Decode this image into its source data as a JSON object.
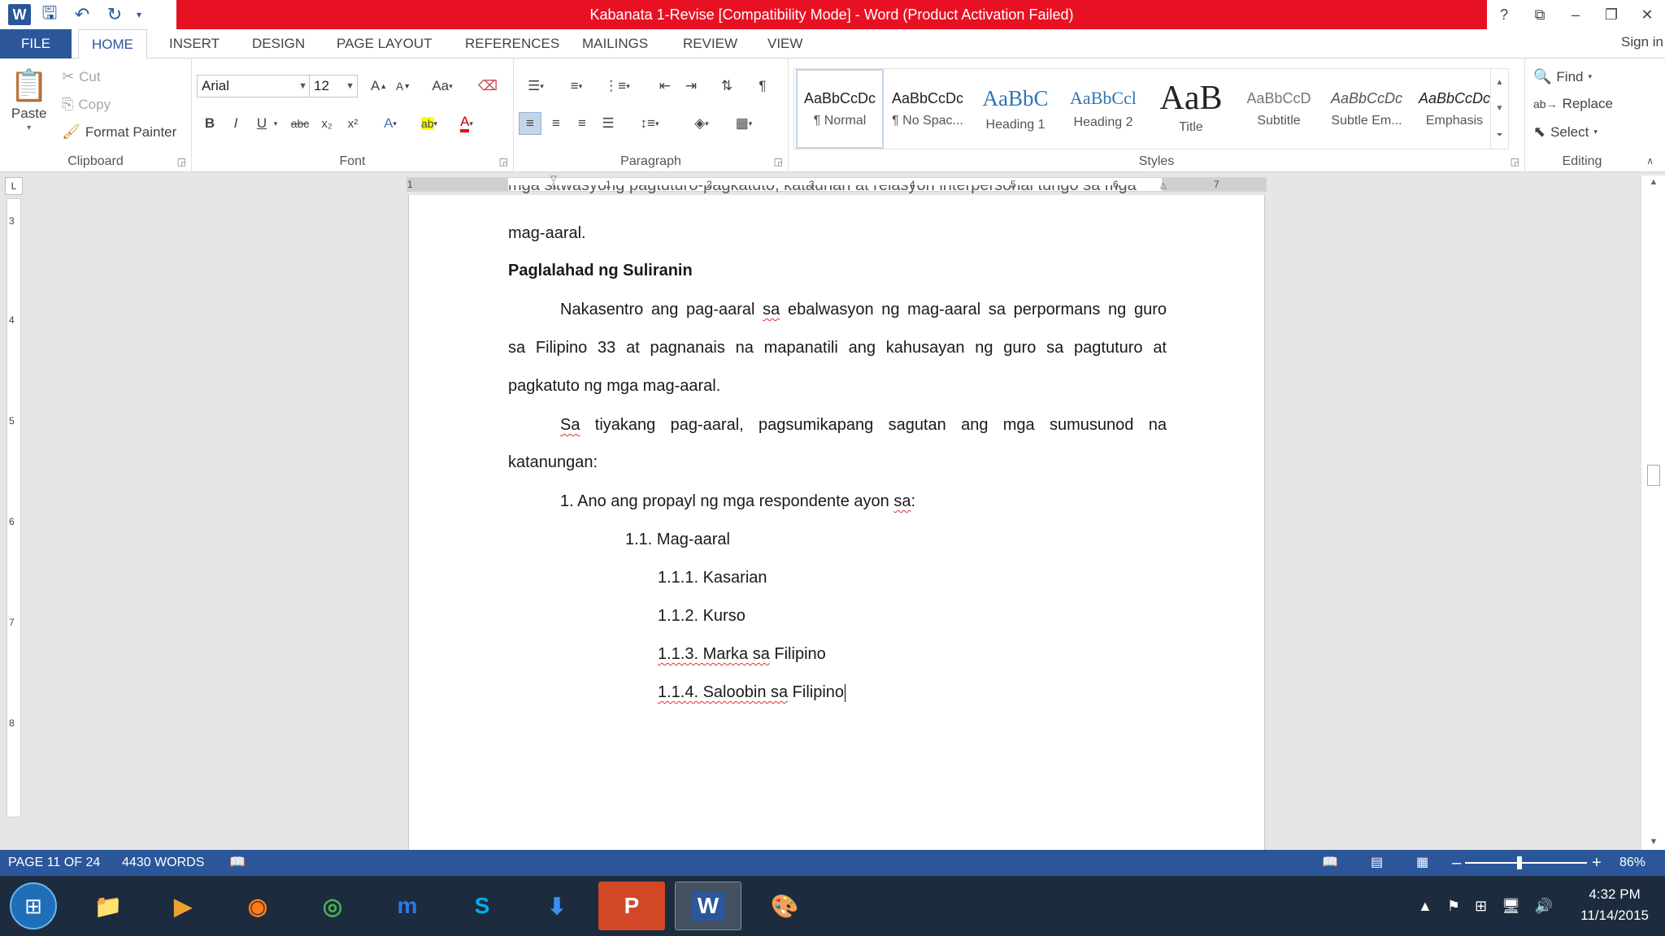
{
  "titlebar": {
    "title": "Kabanata 1-Revise [Compatibility Mode] - Word (Product Activation Failed)",
    "help": "?",
    "ribbon_display": "⧉",
    "minimize": "–",
    "restore": "❐",
    "close": "✕"
  },
  "quick_access": {
    "word_icon": "W",
    "save": "🖫",
    "undo": "↶",
    "redo": "↻",
    "customize": "▾"
  },
  "tabs": [
    "FILE",
    "HOME",
    "INSERT",
    "DESIGN",
    "PAGE LAYOUT",
    "REFERENCES",
    "MAILINGS",
    "REVIEW",
    "VIEW"
  ],
  "sign_in": "Sign in",
  "clipboard": {
    "paste": "Paste",
    "cut": "Cut",
    "copy": "Copy",
    "format_painter": "Format Painter",
    "label": "Clipboard"
  },
  "font": {
    "name": "Arial",
    "size": "12",
    "grow": "A",
    "shrink": "A",
    "change_case": "Aa",
    "bold": "B",
    "italic": "I",
    "underline": "U",
    "strike": "abc",
    "sub": "x₂",
    "sup": "x²",
    "text_effects": "A",
    "highlight": "ab",
    "font_color": "A",
    "label": "Font"
  },
  "paragraph": {
    "label": "Paragraph"
  },
  "styles": {
    "label": "Styles",
    "items": [
      {
        "preview": "AaBbCcDc",
        "name": "¶ Normal"
      },
      {
        "preview": "AaBbCcDc",
        "name": "¶ No Spac..."
      },
      {
        "preview": "AaBbC",
        "name": "Heading 1"
      },
      {
        "preview": "AaBbCcl",
        "name": "Heading 2"
      },
      {
        "preview": "AaB",
        "name": "Title"
      },
      {
        "preview": "AaBbCcD",
        "name": "Subtitle"
      },
      {
        "preview": "AaBbCcDc",
        "name": "Subtle Em..."
      },
      {
        "preview": "AaBbCcDc",
        "name": "Emphasis"
      }
    ]
  },
  "editing": {
    "find": "Find",
    "replace": "Replace",
    "select": "Select",
    "label": "Editing"
  },
  "ruler": {
    "corner": "L",
    "h_numbers": [
      "1",
      "1",
      "2",
      "3",
      "4",
      "5",
      "6",
      "7"
    ],
    "v_numbers": [
      "3",
      "4",
      "5",
      "6",
      "7",
      "8"
    ]
  },
  "document": {
    "top_cut": "mga sitwasyong pagtuturo-pagkatuto, katauhan at relasyon interpersonal tungo sa mga",
    "line1": "mag-aaral.",
    "heading": "Paglalahad ng Suliranin",
    "p1_a_pre": "Nakasentro ang pag-aaral ",
    "p1_a_sq": "sa",
    "p1_a_post": " ebalwasyon ng mag-aaral sa perpormans ng guro",
    "p1_b": "sa Filipino 33 at pagnanais na mapanatili ang kahusayan ng guro sa pagtuturo at",
    "p1_c": "pagkatuto ng mga mag-aaral.",
    "p2_a_sq": "Sa",
    "p2_a_post": " tiyakang pag-aaral, pagsumikapang sagutan ang mga sumusunod na",
    "p2_b": "katanungan:",
    "q1_pre": "1. Ano ang propayl ng mga respondente ayon ",
    "q1_sq": "sa",
    "q1_post": ":",
    "q11": "1.1. Mag-aaral",
    "q111": "1.1.1. Kasarian",
    "q112": "1.1.2. Kurso",
    "q113_sq": "1.1.3. Marka sa",
    "q113_post": " Filipino",
    "q114_sq": "1.1.4. Saloobin sa",
    "q114_post": " Filipino"
  },
  "status": {
    "page": "PAGE 11 OF 24",
    "words": "4430 WORDS",
    "zoom_minus": "–",
    "zoom_plus": "+",
    "zoom": "86%"
  },
  "taskbar": {
    "apps": [
      "explorer",
      "media-player",
      "firefox",
      "chrome",
      "maxthon",
      "skype",
      "downloader",
      "powerpoint",
      "word",
      "paint"
    ],
    "time": "4:32 PM",
    "date": "11/14/2015"
  },
  "colors": {
    "accent": "#2b579a",
    "title_bar_alert": "#e81123",
    "taskbar": "#1c2b3e"
  }
}
